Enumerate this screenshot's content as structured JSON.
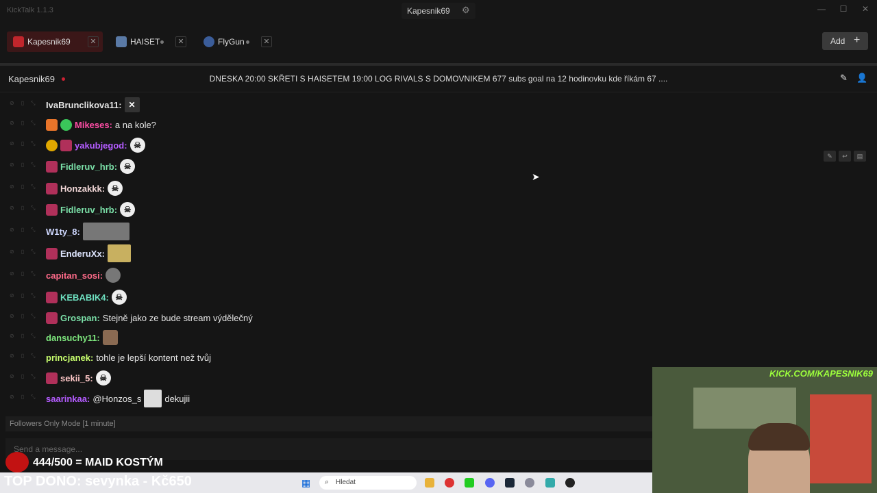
{
  "app": {
    "title": "KickTalk 1.1.3"
  },
  "titlebar": {
    "channel": "Kapesnik69"
  },
  "tabs": [
    {
      "label": "Kapesnik69",
      "active": true
    },
    {
      "label": "HAISET",
      "active": false
    },
    {
      "label": "FlyGun",
      "active": false
    }
  ],
  "add_button": {
    "label": "Add"
  },
  "channel": {
    "name": "Kapesnik69",
    "title": "DNESKA 20:00 SKŘETI S HAISETEM 19:00 LOG RIVALS S DOMOVNIKEM 677 subs goal na 12 hodinovku kde říkám 67 ...."
  },
  "messages": [
    {
      "user": "IvaBrunclikova11:",
      "color": "#e6e6e6",
      "text": ""
    },
    {
      "user": "Mikeses:",
      "color": "#ff4da6",
      "text": "a na kole?"
    },
    {
      "user": "yakubjegod:",
      "color": "#b45cff",
      "text": ""
    },
    {
      "user": "Fidleruv_hrb:",
      "color": "#7be0a8",
      "text": ""
    },
    {
      "user": "Honzakkk:",
      "color": "#f0d6d6",
      "text": ""
    },
    {
      "user": "Fidleruv_hrb:",
      "color": "#7be0a8",
      "text": ""
    },
    {
      "user": "W1ty_8:",
      "color": "#cfd8ff",
      "text": ""
    },
    {
      "user": "EnderuXx:",
      "color": "#dfe6ff",
      "text": ""
    },
    {
      "user": "capitan_sosi:",
      "color": "#ff6b8a",
      "text": ""
    },
    {
      "user": "KEBABIK4:",
      "color": "#6ee0c0",
      "text": ""
    },
    {
      "user": "Grospan:",
      "color": "#7be0a8",
      "text": "Stejně jako ze bude stream výdělečný"
    },
    {
      "user": "dansuchy11:",
      "color": "#7ee87e",
      "text": ""
    },
    {
      "user": "princjanek:",
      "color": "#c8ff6e",
      "text": "tohle je lepší kontent než tvůj"
    },
    {
      "user": "sekii_5:",
      "color": "#ffc8c8",
      "text": ""
    },
    {
      "user": "saarinkaa:",
      "color": "#b45cff",
      "text": "@Honzos_s",
      "text2": "dekujii"
    }
  ],
  "followers_mode": "Followers Only Mode [1 minute]",
  "input": {
    "placeholder": "Send a message..."
  },
  "overlay": {
    "goal": "444/500 = MAID KOSTÝM",
    "top_dono": "TOP DONO: sevynka - Kč650"
  },
  "taskbar": {
    "search": "Hledat"
  },
  "webcam": {
    "url": "KICK.COM/KAPESNIK69"
  }
}
